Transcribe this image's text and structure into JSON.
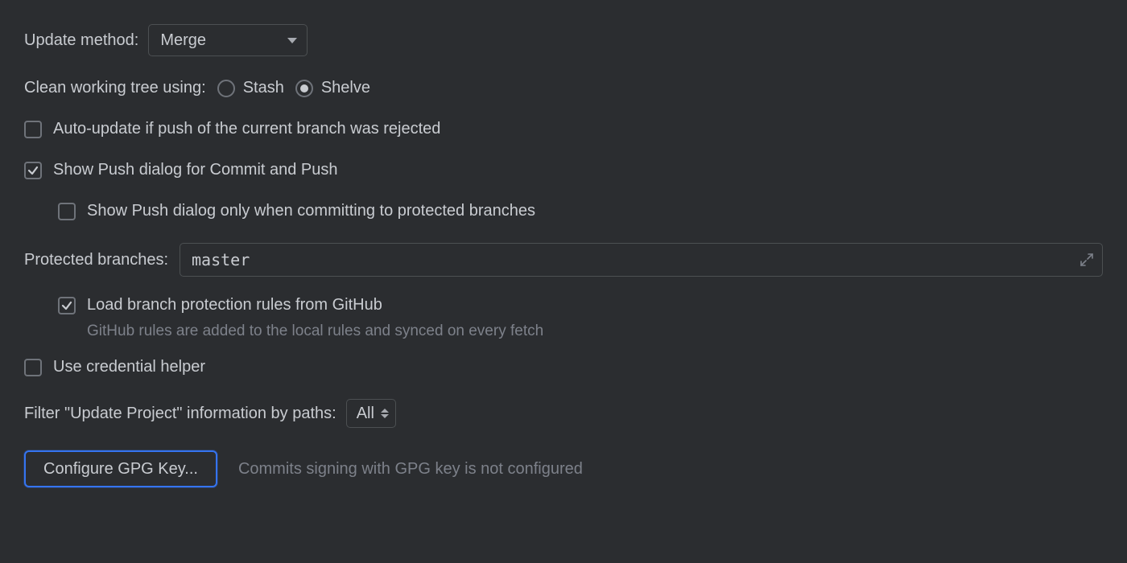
{
  "update_method": {
    "label": "Update method:",
    "value": "Merge"
  },
  "clean_tree": {
    "label": "Clean working tree using:",
    "options": {
      "stash": "Stash",
      "shelve": "Shelve"
    },
    "selected": "shelve"
  },
  "auto_update": {
    "label": "Auto-update if push of the current branch was rejected",
    "checked": false
  },
  "show_push": {
    "label": "Show Push dialog for Commit and Push",
    "checked": true
  },
  "show_push_protected": {
    "label": "Show Push dialog only when committing to protected branches",
    "checked": false
  },
  "protected_branches": {
    "label": "Protected branches:",
    "value": "master"
  },
  "load_branch_rules": {
    "label": "Load branch protection rules from GitHub",
    "checked": true,
    "hint": "GitHub rules are added to the local rules and synced on every fetch"
  },
  "credential_helper": {
    "label": "Use credential helper",
    "checked": false
  },
  "filter_paths": {
    "label": "Filter \"Update Project\" information by paths:",
    "value": "All"
  },
  "gpg": {
    "button": "Configure GPG Key...",
    "status": "Commits signing with GPG key is not configured"
  }
}
